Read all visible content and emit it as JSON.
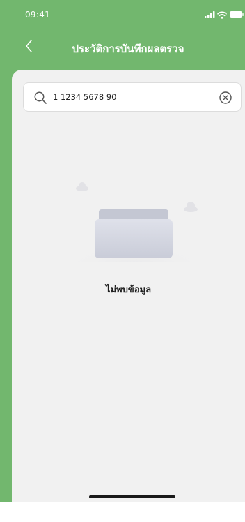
{
  "status_bar": {
    "time": "09:41",
    "icons": [
      "signal-icon",
      "wifi-icon",
      "battery-icon"
    ]
  },
  "nav": {
    "back_icon": "chevron-left-icon",
    "title": "ประวัติการบันทึกผลตรวจ"
  },
  "search": {
    "value": "1 1234 5678 90",
    "placeholder": "",
    "search_icon": "search-icon",
    "clear_icon": "clear-icon"
  },
  "empty_state": {
    "illustration": "empty-folder-icon",
    "message": "ไม่พบข้อมูล"
  },
  "colors": {
    "header_green": "#72b76e",
    "content_background": "#f1f1f1",
    "text_dark": "#1f1f1f"
  }
}
